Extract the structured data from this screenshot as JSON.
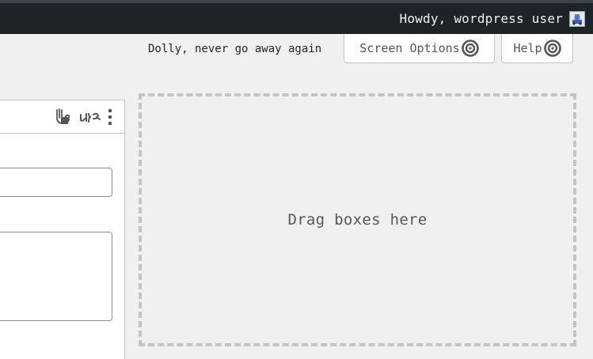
{
  "admin_bar": {
    "greeting": "Howdy, wordpress user",
    "avatar_icon": "user-avatar"
  },
  "header": {
    "dolly_quote": "Dolly, never go away again",
    "screen_options_label": "Screen Options",
    "help_label": "Help",
    "tab_icon": "target-icon"
  },
  "postbox": {
    "header_icons": [
      "hand-drag-icon",
      "boxed-icon",
      "more-options-icon"
    ]
  },
  "dropzone": {
    "label": "Drag boxes here"
  },
  "colors": {
    "admin_bar_bg": "#1d2327",
    "page_bg": "#f0f0f1",
    "border": "#c3c4c7",
    "text_muted": "#50575e"
  }
}
